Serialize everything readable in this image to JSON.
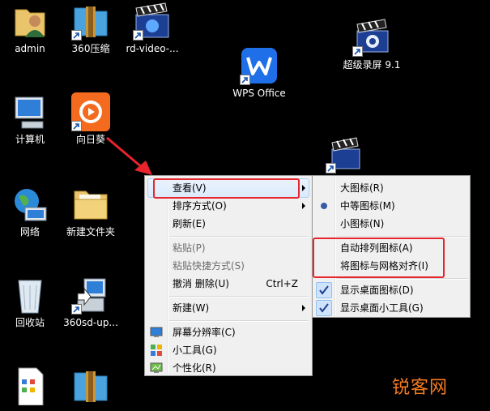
{
  "desktop_icons": [
    {
      "id": "admin",
      "label": "admin",
      "icon": "user-folder-icon"
    },
    {
      "id": "360zip",
      "label": "360压缩",
      "icon": "archive-icon"
    },
    {
      "id": "rdvideo",
      "label": "rd-video-...",
      "icon": "video-clapper-icon"
    },
    {
      "id": "wps",
      "label": "WPS Office",
      "icon": "wps-icon"
    },
    {
      "id": "recorder",
      "label": "超级录屏 9.1",
      "icon": "screen-recorder-icon"
    },
    {
      "id": "computer",
      "label": "计算机",
      "icon": "computer-icon"
    },
    {
      "id": "sunflower",
      "label": "向日葵",
      "icon": "sunflower-remote-icon"
    },
    {
      "id": "network",
      "label": "网络",
      "icon": "network-globe-icon"
    },
    {
      "id": "newfolder",
      "label": "新建文件夹",
      "icon": "folder-icon"
    },
    {
      "id": "recycle",
      "label": "回收站",
      "icon": "recycle-bin-icon"
    },
    {
      "id": "360sd",
      "label": "360sd-up...",
      "icon": "installer-icon"
    }
  ],
  "context_menu": {
    "view": "查看(V)",
    "sort": "排序方式(O)",
    "refresh": "刷新(E)",
    "paste": "粘贴(P)",
    "paste_shortcut": "粘贴快捷方式(S)",
    "undo": "撤消 删除(U)",
    "undo_shortcut": "Ctrl+Z",
    "new": "新建(W)",
    "resolution": "屏幕分辨率(C)",
    "gadgets": "小工具(G)",
    "personalize": "个性化(R)"
  },
  "view_submenu": {
    "large": "大图标(R)",
    "medium": "中等图标(M)",
    "small": "小图标(N)",
    "auto_arrange": "自动排列图标(A)",
    "align_grid": "将图标与网格对齐(I)",
    "show_desktop_icons": "显示桌面图标(D)",
    "show_gadgets": "显示桌面小工具(G)"
  },
  "watermark": "锐客网",
  "colors": {
    "annotation_red": "#e8242c",
    "watermark_orange": "#f47b20"
  }
}
